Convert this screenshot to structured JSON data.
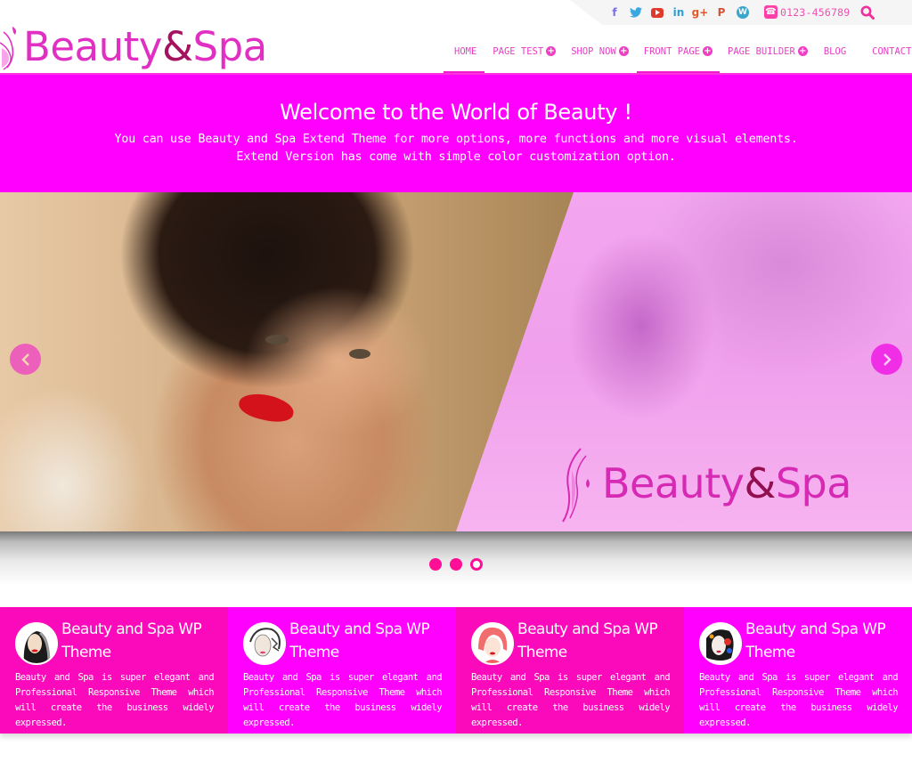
{
  "topbar": {
    "social": [
      {
        "name": "facebook-icon",
        "glyph": "f",
        "color": "#7b6ee8"
      },
      {
        "name": "twitter-icon",
        "glyph": "♥",
        "color": "#3ba7e0"
      },
      {
        "name": "youtube-icon",
        "glyph": "",
        "color": "#e03a2c"
      },
      {
        "name": "linkedin-icon",
        "glyph": "in",
        "color": "#2d9fd8"
      },
      {
        "name": "google-plus-icon",
        "glyph": "g+",
        "color": "#e05a2c"
      },
      {
        "name": "pinterest-icon",
        "glyph": "P",
        "color": "#d2543a"
      },
      {
        "name": "wordpress-icon",
        "glyph": "W",
        "color": "#3aa6cc"
      }
    ],
    "phone_icon": "☎",
    "phone": "0123-456789",
    "search_icon": "search-icon"
  },
  "header": {
    "logo": {
      "part1": "Beauty",
      "amp": "&",
      "part2": "Spa"
    },
    "nav": [
      {
        "label": "HOME",
        "active": true,
        "has_submenu": false
      },
      {
        "label": "PAGE TEST",
        "active": false,
        "has_submenu": true
      },
      {
        "label": "SHOP NOW",
        "active": false,
        "has_submenu": true
      },
      {
        "label": "FRONT PAGE",
        "active": true,
        "has_submenu": true
      },
      {
        "label": "PAGE BUILDER",
        "active": false,
        "has_submenu": true
      },
      {
        "label": "BLOG",
        "active": false,
        "has_submenu": false
      },
      {
        "label": "CONTACT",
        "active": false,
        "has_submenu": false
      }
    ],
    "submenu_glyph": "+"
  },
  "welcome": {
    "title": "Welcome to the World of Beauty !",
    "line1": "You can use Beauty and Spa Extend Theme for more options, more functions and more visual elements.",
    "line2": "Extend Version has come with simple color customization option."
  },
  "slider": {
    "slide_logo": {
      "part1": "Beauty",
      "amp": "&",
      "part2": "Spa"
    },
    "prev_glyph": "‹",
    "next_glyph": "›",
    "dots": [
      {
        "current": false
      },
      {
        "current": false
      },
      {
        "current": true
      }
    ]
  },
  "features": [
    {
      "title": "Beauty and Spa WP Theme",
      "text": "Beauty and Spa is super elegant and Professional Responsive Theme which will create the business widely expressed.",
      "variant": "c1",
      "avatar": "avatar-dark-hair"
    },
    {
      "title": "Beauty and Spa WP Theme",
      "text": "Beauty and Spa is super elegant and Professional Responsive Theme which will create the business widely expressed.",
      "variant": "c2",
      "avatar": "avatar-sketch"
    },
    {
      "title": "Beauty and Spa WP Theme",
      "text": "Beauty and Spa is super elegant and Professional Responsive Theme which will create the business widely expressed.",
      "variant": "c1",
      "avatar": "avatar-pink-hair"
    },
    {
      "title": "Beauty and Spa WP Theme",
      "text": "Beauty and Spa is super elegant and Professional Responsive Theme which will create the business widely expressed.",
      "variant": "c2",
      "avatar": "avatar-colorful"
    }
  ],
  "colors": {
    "brand_magenta": "#ff00ff",
    "brand_pink": "#fa0aba",
    "nav_text": "#e63fc4",
    "logo_amp": "#a5125f",
    "dot": "#ff0f96"
  }
}
